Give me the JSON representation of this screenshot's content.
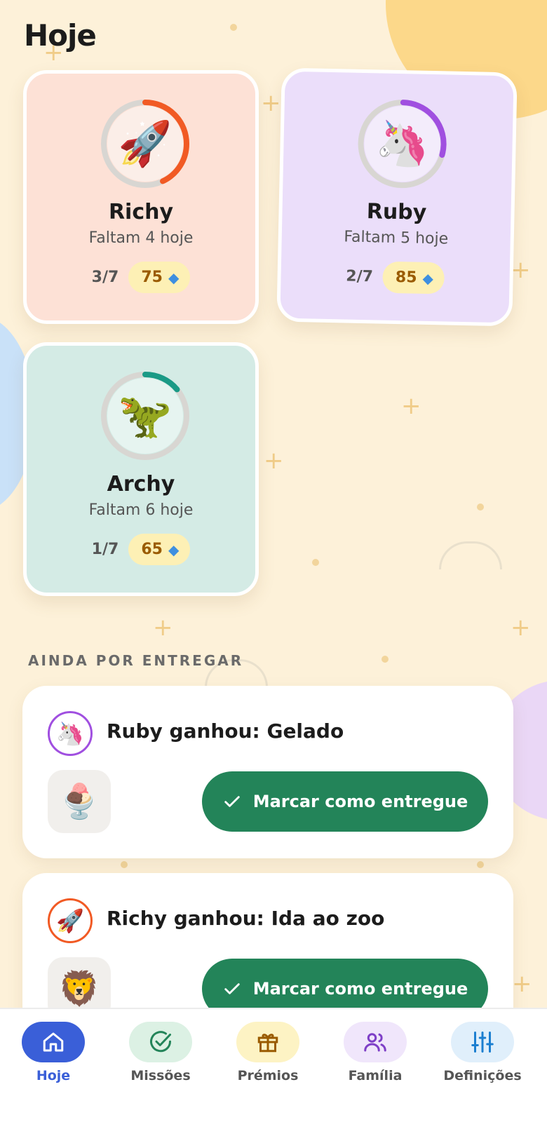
{
  "header": {
    "title": "Hoje"
  },
  "kids": [
    {
      "name": "Richy",
      "avatar": "🚀",
      "avatar_icon": "rocket-icon",
      "remaining": "Faltam 4 hoje",
      "progress_text": "3/7",
      "progress_fraction": 0.43,
      "gems": "75",
      "ring_color": "#f15a24",
      "card_color": "#fde1d6"
    },
    {
      "name": "Ruby",
      "avatar": "🦄",
      "avatar_icon": "unicorn-icon",
      "remaining": "Faltam 5 hoje",
      "progress_text": "2/7",
      "progress_fraction": 0.29,
      "gems": "85",
      "ring_color": "#a04fe0",
      "card_color": "#ebdefa"
    },
    {
      "name": "Archy",
      "avatar": "🦖",
      "avatar_icon": "dinosaur-icon",
      "remaining": "Faltam 6 hoje",
      "progress_text": "1/7",
      "progress_fraction": 0.14,
      "gems": "65",
      "ring_color": "#1a9a86",
      "card_color": "#d4ebe5"
    }
  ],
  "gem_icon": "gem-icon",
  "pending": {
    "section_label": "AINDA POR ENTREGAR",
    "items": [
      {
        "title": "Ruby ganhou: Gelado",
        "avatar": "🦄",
        "avatar_icon": "unicorn-icon",
        "avatar_border": "#a04fe0",
        "reward_image": "🍨",
        "reward_icon": "ice-cream-icon",
        "button_label": "Marcar como entregue"
      },
      {
        "title": "Richy ganhou: Ida ao zoo",
        "avatar": "🚀",
        "avatar_icon": "rocket-icon",
        "avatar_border": "#f15a24",
        "reward_image": "🦁",
        "reward_icon": "lion-icon",
        "button_label": "Marcar como entregue"
      }
    ]
  },
  "tabs": [
    {
      "label": "Hoje",
      "icon": "home-icon",
      "active": true,
      "pill_color": "#3a5fd8"
    },
    {
      "label": "Missões",
      "icon": "check-circle-icon",
      "active": false,
      "pill_color": "#dcf1e4"
    },
    {
      "label": "Prémios",
      "icon": "gift-icon",
      "active": false,
      "pill_color": "#fdf3c4"
    },
    {
      "label": "Família",
      "icon": "family-icon",
      "active": false,
      "pill_color": "#f0e6fb"
    },
    {
      "label": "Definições",
      "icon": "sliders-icon",
      "active": false,
      "pill_color": "#e0effb"
    }
  ]
}
